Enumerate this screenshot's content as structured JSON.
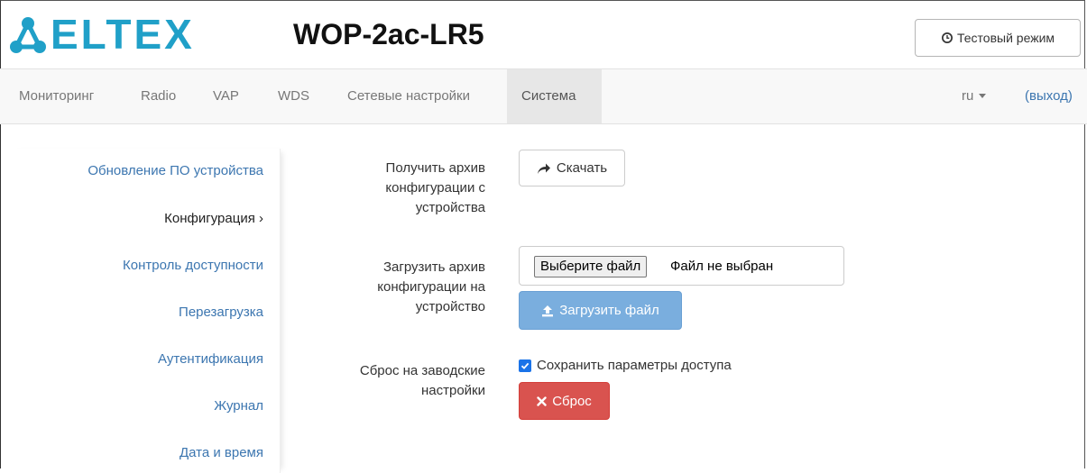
{
  "header": {
    "logo_text": "ELTEX",
    "model": "WOP-2ac-LR5",
    "test_mode_label": "Тестовый режим",
    "test_mode_icon": "clock-icon"
  },
  "nav": {
    "items": [
      {
        "label": "Мониторинг"
      },
      {
        "label": "Radio"
      },
      {
        "label": "VAP"
      },
      {
        "label": "WDS"
      },
      {
        "label": "Сетевые настройки"
      },
      {
        "label": "Система",
        "active": true
      }
    ],
    "language": "ru",
    "logout": "(выход)"
  },
  "sidebar": {
    "items": [
      {
        "label": "Обновление ПО устройства"
      },
      {
        "label": "Конфигурация ›",
        "active": true
      },
      {
        "label": "Контроль доступности"
      },
      {
        "label": "Перезагрузка"
      },
      {
        "label": "Аутентификация"
      },
      {
        "label": "Журнал"
      },
      {
        "label": "Дата и время"
      }
    ]
  },
  "form": {
    "download": {
      "label_lines": [
        "Получить архив",
        "конфигурации с",
        "устройства"
      ],
      "button": "Скачать",
      "button_icon": "share-arrow-icon"
    },
    "upload": {
      "label_lines": [
        "Загрузить архив",
        "конфигурации на",
        "устройство"
      ],
      "choose_button": "Выберите файл",
      "file_status": "Файл не выбран",
      "button": "Загрузить файл",
      "button_icon": "upload-icon"
    },
    "reset": {
      "label_lines": [
        "Сброс на заводские",
        "настройки"
      ],
      "keep_access_label": "Сохранить параметры доступа",
      "keep_access_checked": true,
      "button": "Сброс",
      "button_icon": "close-icon"
    }
  },
  "colors": {
    "logo": "#20a0c8",
    "link": "#3c76b0",
    "primary": "#7aaede",
    "danger": "#d9534f",
    "checkbox": "#1a73e8"
  }
}
